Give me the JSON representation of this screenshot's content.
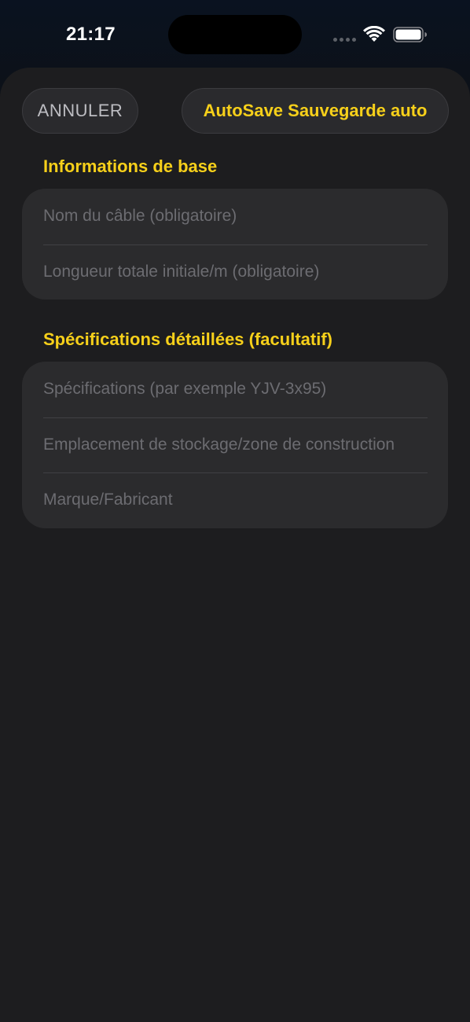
{
  "status_bar": {
    "time": "21:17",
    "icons": [
      "cellular-signal-icon",
      "wifi-icon",
      "battery-icon"
    ]
  },
  "toolbar": {
    "cancel_label": "ANNULER",
    "save_label": "AutoSave Sauvegarde auto"
  },
  "sections": [
    {
      "title": "Informations de base",
      "fields": [
        {
          "placeholder": "Nom du câble (obligatoire)",
          "value": ""
        },
        {
          "placeholder": "Longueur totale initiale/m (obligatoire)",
          "value": ""
        }
      ]
    },
    {
      "title": "Spécifications détaillées (facultatif)",
      "fields": [
        {
          "placeholder": "Spécifications (par exemple YJV-3x95)",
          "value": ""
        },
        {
          "placeholder": "Emplacement de stockage/zone de construction",
          "value": ""
        },
        {
          "placeholder": "Marque/Fabricant",
          "value": ""
        }
      ]
    }
  ],
  "colors": {
    "accent": "#f7d01a",
    "sheet_background": "#1d1d1f",
    "card_background": "#2b2b2d",
    "placeholder_text": "#6c6c71"
  }
}
